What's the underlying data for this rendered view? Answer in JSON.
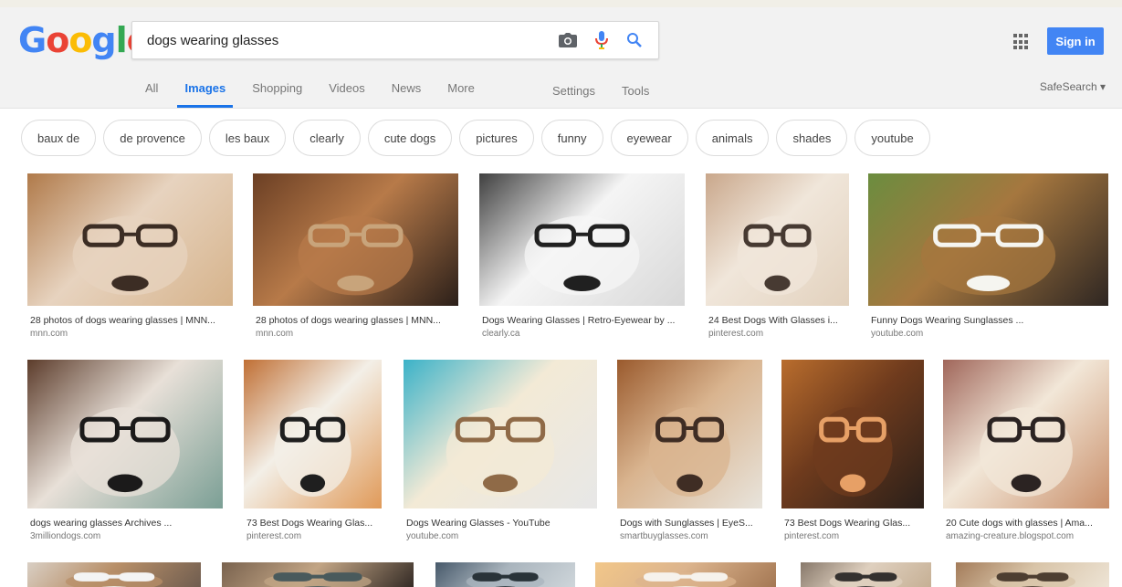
{
  "search": {
    "query": "dogs wearing glasses"
  },
  "logo": {
    "letters": [
      "G",
      "o",
      "o",
      "g",
      "l",
      "e"
    ]
  },
  "header": {
    "sign_in": "Sign in",
    "safesearch": "SafeSearch ▾"
  },
  "tabs": [
    {
      "label": "All"
    },
    {
      "label": "Images",
      "active": true
    },
    {
      "label": "Shopping"
    },
    {
      "label": "Videos"
    },
    {
      "label": "News"
    },
    {
      "label": "More"
    }
  ],
  "tools": [
    {
      "label": "Settings"
    },
    {
      "label": "Tools"
    }
  ],
  "chips": [
    "baux de",
    "de provence",
    "les baux",
    "clearly",
    "cute dogs",
    "pictures",
    "funny",
    "eyewear",
    "animals",
    "shades",
    "youtube"
  ],
  "results": [
    {
      "caption": "28 photos of dogs wearing glasses | MNN...",
      "domain": "mnn.com",
      "colors": [
        "#b07a4a",
        "#e7d3bf",
        "#3c2d24",
        "#d6b38b"
      ]
    },
    {
      "caption": "28 photos of dogs wearing glasses | MNN...",
      "domain": "mnn.com",
      "colors": [
        "#6b3f24",
        "#b77a49",
        "#c8a47b",
        "#2b1f19"
      ]
    },
    {
      "caption": "Dogs Wearing Glasses | Retro-Eyewear by ...",
      "domain": "clearly.ca",
      "colors": [
        "#404040",
        "#f5f5f5",
        "#202020",
        "#d8d8d8"
      ]
    },
    {
      "caption": "24 Best Dogs With Glasses i...",
      "domain": "pinterest.com",
      "colors": [
        "#c9a78b",
        "#f0e6da",
        "#473a32",
        "#e2d1bd"
      ]
    },
    {
      "caption": "Funny Dogs Wearing Sunglasses ...",
      "domain": "youtube.com",
      "colors": [
        "#6b8d3f",
        "#a5773f",
        "#f5f5f0",
        "#2e2622"
      ]
    },
    {
      "caption": "dogs wearing glasses Archives ...",
      "domain": "3milliondogs.com",
      "colors": [
        "#5c3c2b",
        "#e8e0d8",
        "#1b1a1a",
        "#7b9f95"
      ]
    },
    {
      "caption": "73 Best Dogs Wearing Glas...",
      "domain": "pinterest.com",
      "colors": [
        "#c06f34",
        "#f3efe7",
        "#1f1f1f",
        "#e09a59"
      ]
    },
    {
      "caption": "Dogs Wearing Glasses - YouTube",
      "domain": "youtube.com",
      "colors": [
        "#3bb2c8",
        "#f3ead6",
        "#8f6a47",
        "#e7e7e7"
      ]
    },
    {
      "caption": "Dogs with Sunglasses | EyeS...",
      "domain": "smartbuyglasses.com",
      "colors": [
        "#9a5a2d",
        "#d9b48f",
        "#3f2d24",
        "#e8e4dc"
      ]
    },
    {
      "caption": "73 Best Dogs Wearing Glas...",
      "domain": "pinterest.com",
      "colors": [
        "#b96d2d",
        "#6f3b1d",
        "#e7a066",
        "#2a1f19"
      ]
    },
    {
      "caption": "20 Cute dogs with glasses | Ama...",
      "domain": "amazing-creature.blogspot.com",
      "colors": [
        "#a0665a",
        "#f2e7d8",
        "#2b2322",
        "#c98f6a"
      ]
    },
    {
      "caption": "",
      "domain": "",
      "colors": [
        "#d9cfc4",
        "#b88f68",
        "#f4f4f4",
        "#6b5a4e"
      ]
    },
    {
      "caption": "",
      "domain": "",
      "colors": [
        "#79624e",
        "#c2a585",
        "#495a5c",
        "#2c2420"
      ]
    },
    {
      "caption": "",
      "domain": "",
      "colors": [
        "#47596a",
        "#a9b4bd",
        "#293339",
        "#d1d8dc"
      ]
    },
    {
      "caption": "",
      "domain": "",
      "colors": [
        "#f2c789",
        "#dcb48d",
        "#f6f2ec",
        "#a17450"
      ]
    },
    {
      "caption": "",
      "domain": "",
      "colors": [
        "#87786a",
        "#dfd0bf",
        "#34312f",
        "#c4ad91"
      ]
    },
    {
      "caption": "",
      "domain": "",
      "colors": [
        "#a37b59",
        "#d8c4a8",
        "#4d3e31",
        "#efe6d8"
      ]
    }
  ]
}
